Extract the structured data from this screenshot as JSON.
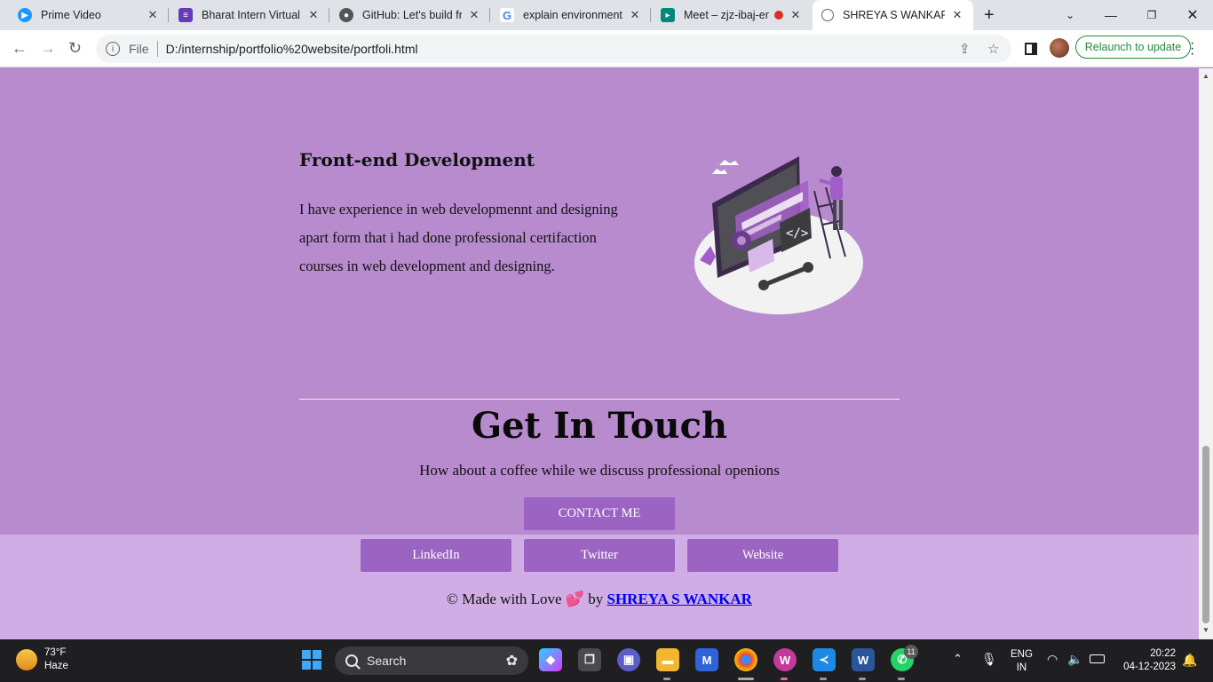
{
  "browser": {
    "tabs": [
      {
        "title": "Prime Video",
        "favicon": "prime-video-icon",
        "color": "#1a98ff"
      },
      {
        "title": "Bharat Intern Virtual I",
        "favicon": "forms-icon",
        "color": "#673ab7"
      },
      {
        "title": "GitHub: Let's build fro",
        "favicon": "github-icon",
        "color": "#555555"
      },
      {
        "title": "explain environmenta",
        "favicon": "google-icon",
        "color": "#4285f4"
      },
      {
        "title": "Meet – zjz-ibaj-er",
        "favicon": "meet-icon",
        "color": "#00897b"
      },
      {
        "title": "SHREYA S WANKAR",
        "favicon": "globe-icon",
        "color": "#5f6368"
      }
    ],
    "new_tab": "+",
    "address": {
      "scheme_label": "File",
      "url": "D:/internship/portfolio%20website/portfoli.html"
    },
    "relaunch_label": "Relaunch to update"
  },
  "page": {
    "section": {
      "title": "Front-end Development",
      "text": "I have experience in web developmennt and designing apart form that i had done professional certifaction courses in web development and designing."
    },
    "contact": {
      "title": "Get In Touch",
      "subtitle": "How about a coffee while we discuss professional openions",
      "contact_button": "CONTACT ME",
      "links": [
        "LinkedIn",
        "Twitter",
        "Website"
      ]
    },
    "footer": {
      "prefix": "© Made with Love",
      "heart": "💕",
      "by": "by",
      "author": "SHREYA S WANKAR"
    },
    "colors": {
      "background": "#b88bcf",
      "footer_band": "#d0aee5",
      "button": "#9b64c2"
    }
  },
  "taskbar": {
    "weather": {
      "temp": "73°F",
      "condition": "Haze"
    },
    "search_placeholder": "Search",
    "tray": {
      "lang": "ENG",
      "region": "IN",
      "time": "20:22",
      "date": "04-12-2023"
    },
    "whatsapp_badge": "11"
  }
}
